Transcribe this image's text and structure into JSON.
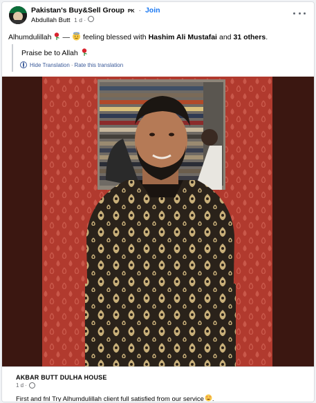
{
  "post": {
    "group_name": "Pakistan's Buy&Sell Group",
    "group_badge": "PK",
    "join_label": "Join",
    "author": "Abdullah Butt",
    "time": "1 d",
    "status_start": "Alhumdulillah",
    "status_dash": "—",
    "status_feeling": "feeling blessed with",
    "tagged_person": "Hashim Ali Mustafai",
    "status_and": "and",
    "others": "31 others",
    "status_end": "."
  },
  "translation": {
    "text": "Praise be to Allah",
    "hide_label": "Hide Translation",
    "separator": "·",
    "rate_label": "Rate this translation"
  },
  "link_preview": {
    "title": "AKBAR BUTT DULHA HOUSE",
    "time": "1 d",
    "caption": "First and fnl Try Alhumdulillah client full satisfied from our service",
    "caption_end": "."
  },
  "icons": {
    "more": "more-options-icon",
    "rose": "rose-emoji-icon",
    "feeling": "blessed-face-emoji-icon",
    "heart_eyes": "heart-eyes-emoji-icon",
    "globe": "globe-icon"
  },
  "colors": {
    "link_blue": "#1877f2",
    "translate_blue": "#385898",
    "meta_gray": "#65676b"
  }
}
